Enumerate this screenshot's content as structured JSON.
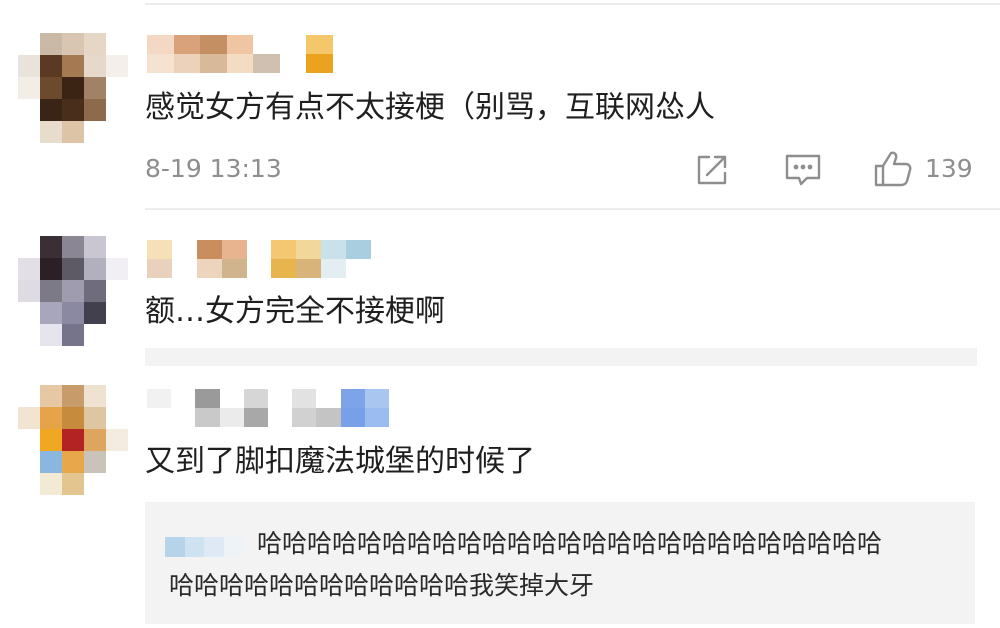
{
  "comments": [
    {
      "text": "感觉女方有点不太接梗（别骂，互联网怂人",
      "timestamp": "8-19 13:13",
      "like_count": "139"
    },
    {
      "text": "额…女方完全不接梗啊"
    },
    {
      "text": "又到了脚扣魔法城堡的时候了",
      "reply": {
        "text_line1": "哈哈哈哈哈哈哈哈哈哈哈哈哈哈哈哈哈哈哈哈哈哈哈哈哈",
        "text_line2": "哈哈哈哈哈哈哈哈哈哈哈哈我笑掉大牙"
      }
    }
  ],
  "icons": {
    "share": "share-icon",
    "comment": "comment-icon",
    "like": "thumbs-up-icon"
  },
  "colors": {
    "text": "#1f1f1f",
    "meta": "#8e8e8e",
    "reply_bg": "#f3f3f3",
    "divider": "#ececec"
  }
}
